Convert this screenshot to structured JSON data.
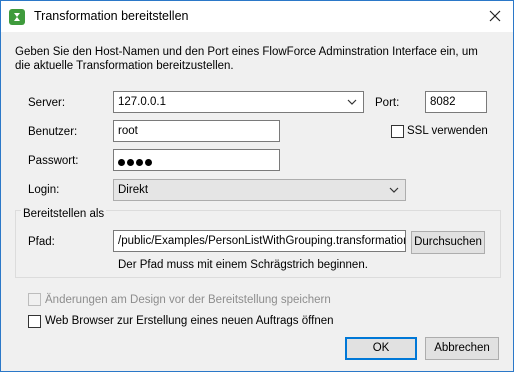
{
  "window": {
    "title": "Transformation bereitstellen",
    "app_icon": "altova-green-icon",
    "close_icon": "close-icon"
  },
  "description": "Geben Sie den Host-Namen und den Port eines FlowForce Adminstration Interface ein, um die aktuelle Transformation bereitzustellen.",
  "server": {
    "label": "Server:",
    "value": "127.0.0.1",
    "port_label": "Port:",
    "port_value": "8082"
  },
  "ssl": {
    "label": "SSL verwenden",
    "checked": false
  },
  "user": {
    "label": "Benutzer:",
    "value": "root"
  },
  "password": {
    "label": "Passwort:",
    "masked_length": 4
  },
  "login": {
    "label": "Login:",
    "value": "Direkt"
  },
  "deploy_group": {
    "title": "Bereitstellen als",
    "path_label": "Pfad:",
    "path_value": "/public/Examples/PersonListWithGrouping.transformation",
    "browse_label": "Durchsuchen",
    "hint": "Der Pfad muss mit einem Schrägstrich beginnen."
  },
  "options": {
    "save_changes": {
      "label": "Änderungen am Design vor der Bereitstellung speichern",
      "checked": false,
      "enabled": false
    },
    "open_browser": {
      "label": "Web Browser zur Erstellung eines neuen Auftrags öffnen",
      "checked": false,
      "enabled": true
    }
  },
  "buttons": {
    "ok": "OK",
    "cancel": "Abbrechen"
  }
}
